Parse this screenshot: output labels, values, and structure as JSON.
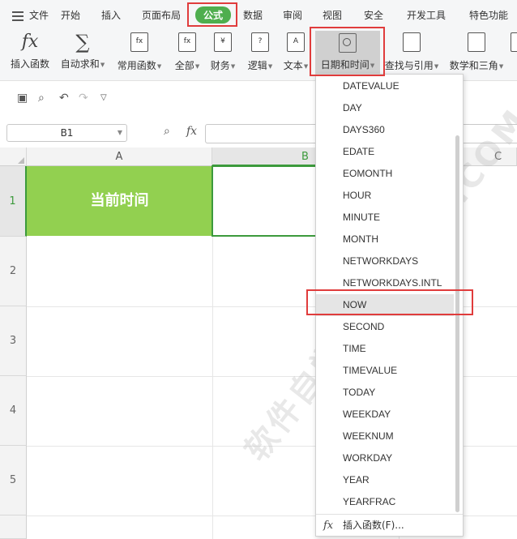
{
  "tabs": {
    "file": "文件",
    "items": [
      "开始",
      "插入",
      "页面布局",
      "公式",
      "数据",
      "审阅",
      "视图",
      "安全",
      "开发工具",
      "特色功能"
    ],
    "active": "公式"
  },
  "ribbon": {
    "insert_function": "插入函数",
    "autosum": "自动求和",
    "common_functions": "常用函数",
    "all": "全部",
    "finance": "财务",
    "logic": "逻辑",
    "text": "文本",
    "datetime": "日期和时间",
    "lookup": "查找与引用",
    "math": "数学和三角",
    "fx_symbol": "fx",
    "sigma_symbol": "∑",
    "finance_glyph": "¥",
    "logic_glyph": "?",
    "text_glyph": "A",
    "all_glyph": "fx",
    "common_glyph": "fx"
  },
  "quick_access": {
    "save_icon": "save-icon",
    "preview_icon": "print-preview-icon",
    "undo_icon": "undo-icon",
    "redo_icon": "redo-icon",
    "more_icon": "more-icon"
  },
  "formula_bar": {
    "name_box": "B1",
    "fx_label": "fx",
    "formula_value": ""
  },
  "sheet": {
    "columns": [
      "A",
      "B",
      "C"
    ],
    "rows": [
      "1",
      "2",
      "3",
      "4",
      "5"
    ],
    "a1_value": "当前时间",
    "a1_fill": "#92d050",
    "selected_cell": "B1",
    "accent": "#3c9a3c"
  },
  "watermark": "软件自学网 RJZXW.COM",
  "dropdown": {
    "items": [
      "DATEVALUE",
      "DAY",
      "DAYS360",
      "EDATE",
      "EOMONTH",
      "HOUR",
      "MINUTE",
      "MONTH",
      "NETWORKDAYS",
      "NETWORKDAYS.INTL",
      "NOW",
      "SECOND",
      "TIME",
      "TIMEVALUE",
      "TODAY",
      "WEEKDAY",
      "WEEKNUM",
      "WORKDAY",
      "YEAR",
      "YEARFRAC"
    ],
    "highlighted": "NOW",
    "footer_fx": "fx",
    "footer_label": "插入函数(F)..."
  },
  "highlight_color": "#e03c3c",
  "active_tab_color": "#4fae4e"
}
